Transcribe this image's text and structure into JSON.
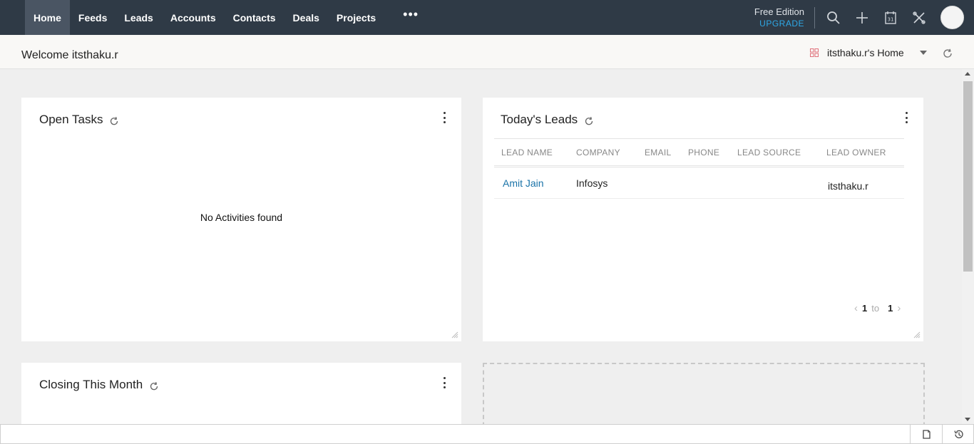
{
  "nav": {
    "items": [
      {
        "label": "Home",
        "active": true
      },
      {
        "label": "Feeds"
      },
      {
        "label": "Leads"
      },
      {
        "label": "Accounts"
      },
      {
        "label": "Contacts"
      },
      {
        "label": "Deals"
      },
      {
        "label": "Projects"
      }
    ],
    "more": "•••"
  },
  "edition": {
    "label": "Free Edition",
    "upgrade": "UPGRADE"
  },
  "welcome": {
    "title": "Welcome itsthaku.r",
    "home_selector": "itsthaku.r's Home"
  },
  "open_tasks": {
    "title": "Open Tasks",
    "empty_message": "No Activities found"
  },
  "todays_leads": {
    "title": "Today's Leads",
    "columns": [
      "LEAD NAME",
      "COMPANY",
      "EMAIL",
      "PHONE",
      "LEAD SOURCE",
      "LEAD OWNER"
    ],
    "rows": [
      {
        "lead_name": "Amit Jain",
        "company": "Infosys",
        "email": "",
        "phone": "",
        "lead_source": "",
        "lead_owner": "itsthaku.r"
      }
    ],
    "pager": {
      "from": "1",
      "to_label": "to",
      "to": "1"
    }
  },
  "closing_this_month": {
    "title": "Closing This Month"
  },
  "colors": {
    "topbar": "#2f3a46",
    "active_tab": "#4a5563",
    "upgrade": "#2ea8e6",
    "link": "#1a73a8"
  }
}
